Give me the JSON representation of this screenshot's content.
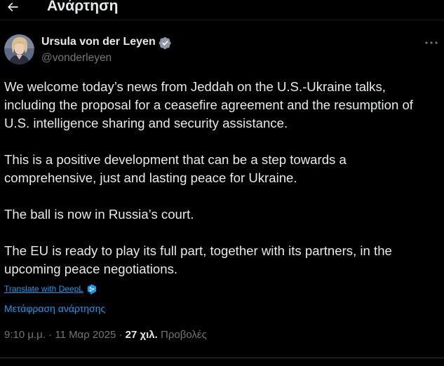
{
  "header": {
    "back_icon": "arrow-left-icon",
    "title": "Ανάρτηση"
  },
  "author": {
    "avatar_icon": "avatar-photo",
    "name": "Ursula von der Leyen",
    "verified_icon": "verified-badge-icon",
    "handle": "@vonderleyen"
  },
  "more_icon": "more-options-icon",
  "post": {
    "paragraphs": [
      "We welcome today’s news from Jeddah on the U.S.-Ukraine talks, including the proposal for a ceasefire agreement and the resumption of U.S. intelligence sharing and security assistance.",
      "This is a positive development that can be a step towards a comprehensive, just and lasting peace for Ukraine.",
      "The ball is now in Russia’s court.",
      "The EU is ready to play its full part, together with its partners, in the upcoming peace negotiations."
    ]
  },
  "translate": {
    "deepl_label": "Translate with DeepL",
    "deepl_icon": "deepl-icon",
    "post_translate_label": "Μετάφραση ανάρτησης"
  },
  "meta": {
    "time": "9:10 μ.μ.",
    "separator1": " · ",
    "date": "11 Μαρ 2025",
    "separator2": " · ",
    "views": "27 χιλ.",
    "views_label": " Προβολές"
  },
  "colors": {
    "background": "#000000",
    "text": "#e7e9ea",
    "secondary": "#71767b",
    "accent": "#1d9bf0"
  }
}
